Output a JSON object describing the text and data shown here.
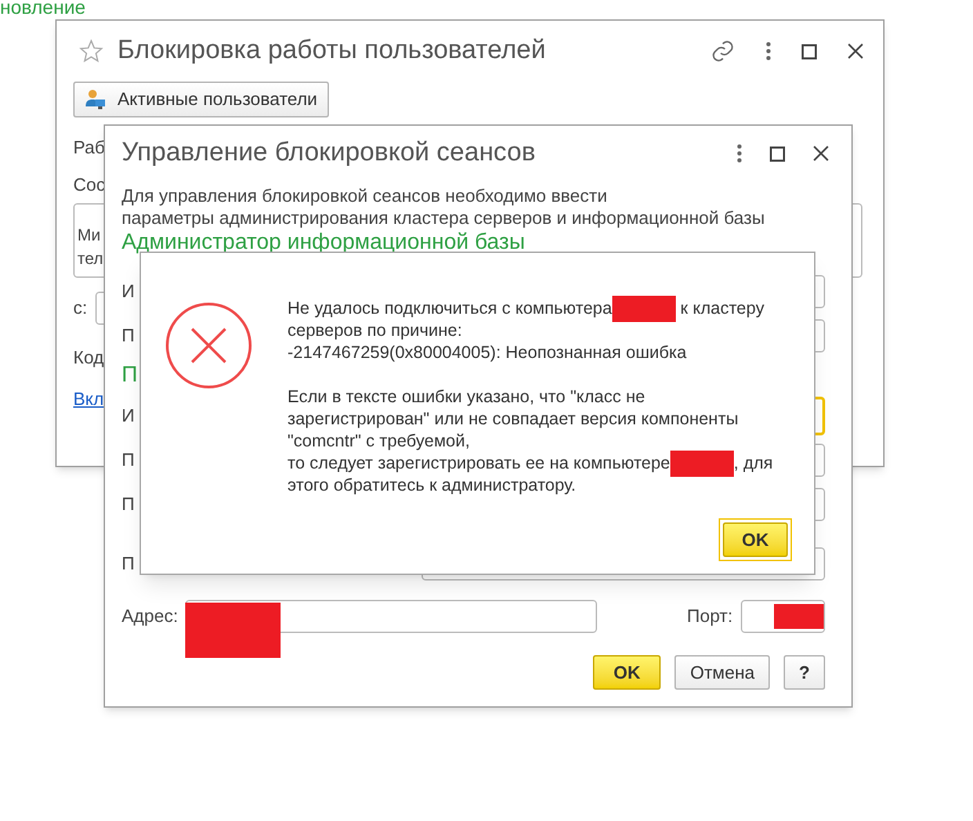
{
  "background_link": "новление",
  "users_window": {
    "title": "Блокировка работы пользователей",
    "active_users_button": "Активные пользователи",
    "rows": [
      {
        "kind": "label",
        "text": "Раб"
      },
      {
        "kind": "label",
        "text": "Сос"
      },
      {
        "kind": "textarea",
        "lines": [
          "Ми",
          "тел"
        ]
      },
      {
        "kind": "input",
        "label": "с:"
      },
      {
        "kind": "label",
        "text": "Код"
      },
      {
        "kind": "link",
        "text": "Вкл"
      }
    ]
  },
  "sessions_window": {
    "title": "Управление блокировкой сеансов",
    "intro": "Для управления блокировкой сеансов необходимо ввести\nпараметры администрирования кластера серверов и информационной базы",
    "rows": [
      {
        "kind": "heading",
        "text": "Администратор информационной базы"
      },
      {
        "kind": "field",
        "label": "И",
        "focused": false
      },
      {
        "kind": "field",
        "label": "П",
        "focused": false
      },
      {
        "kind": "heading",
        "text": "П"
      },
      {
        "kind": "field",
        "label": "И",
        "focused": true
      },
      {
        "kind": "field",
        "label": "П",
        "focused": false
      },
      {
        "kind": "field",
        "label": "П",
        "focused": false
      },
      {
        "kind": "field",
        "label": "П",
        "focused": false
      }
    ],
    "address": {
      "label": "Адрес:",
      "redacted": true
    },
    "port": {
      "label": "Порт:",
      "redacted": true
    },
    "buttons": [
      {
        "kind": "primary",
        "label": "OK"
      },
      {
        "kind": "secondary",
        "label": "Отмена"
      },
      {
        "kind": "secondary",
        "label": "?"
      }
    ]
  },
  "error_dialog": {
    "paragraphs": [
      [
        {
          "kind": "text",
          "text": "Не удалось подключиться с компьютера"
        },
        {
          "kind": "redaction"
        },
        {
          "kind": "text",
          "text": " к кластеру\nсерверов по причине:\n-2147467259(0x80004005): Неопознанная ошибка"
        }
      ],
      [
        {
          "kind": "text",
          "text": "Если в тексте ошибки указано, что \"класс не\nзарегистрирован\" или не совпадает версия компоненты\n\"comcntr\" с требуемой,\nто следует зарегистрировать ее на компьютере"
        },
        {
          "kind": "redaction"
        },
        {
          "kind": "text",
          "text": ", для\nэтого обратитесь к администратору."
        }
      ]
    ],
    "ok_button": "OK"
  }
}
